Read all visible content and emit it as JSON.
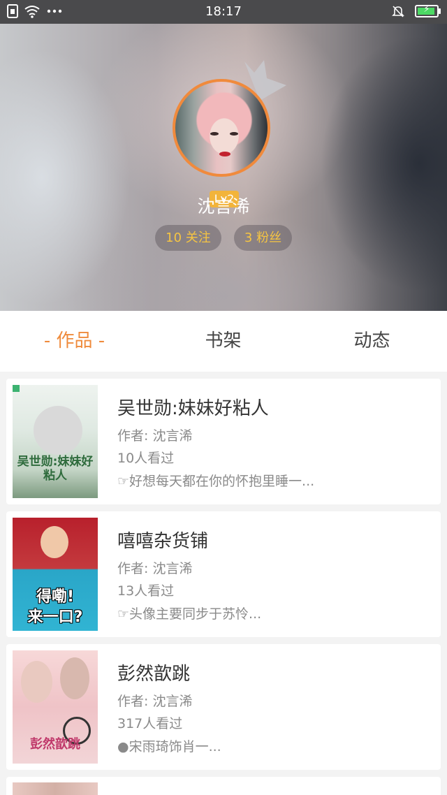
{
  "status_bar": {
    "time": "18:17",
    "left_icons": [
      "sim-icon",
      "wifi-icon",
      "more-dots-icon"
    ],
    "right_icons": [
      "bell-muted-icon",
      "battery-charging-icon"
    ]
  },
  "profile": {
    "level": "Lv2",
    "username": "沈言浠",
    "following": "10 关注",
    "followers": "3 粉丝",
    "accent_color": "#f08a3c",
    "badge_color": "#f2b43b"
  },
  "tabs": [
    {
      "label": "- 作品 -",
      "active": true
    },
    {
      "label": "书架",
      "active": false
    },
    {
      "label": "动态",
      "active": false
    }
  ],
  "works": [
    {
      "title": "吴世勋:妹妹好粘人",
      "author": "作者: 沈言浠",
      "views": "10人看过",
      "desc": "☞好想每天都在你的怀抱里睡一...",
      "cover_text": "吴世勋:妹妹好粘人"
    },
    {
      "title": "嘻嘻杂货铺",
      "author": "作者: 沈言浠",
      "views": "13人看过",
      "desc": "☞头像主要同步于苏怜...",
      "cover_text_1": "得嘞!",
      "cover_text_2": "来一口?"
    },
    {
      "title": "彭然歆跳",
      "author": "作者: 沈言浠",
      "views": "317人看过",
      "desc": "●宋雨琦饰肖一...",
      "cover_text": "彭然歆跳"
    }
  ]
}
